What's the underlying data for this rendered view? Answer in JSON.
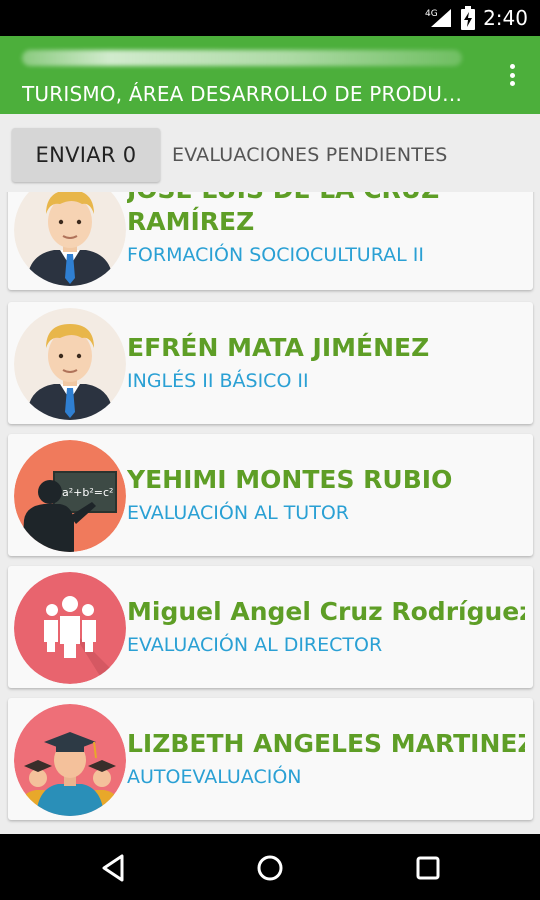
{
  "status_bar": {
    "network_label": "4G",
    "time": "2:40"
  },
  "app_bar": {
    "title": "TURISMO, ÁREA DESARROLLO DE PRODUCT...",
    "color": "#4caf3b"
  },
  "actions": {
    "send_label": "ENVIAR 0",
    "pending_label": "EVALUACIONES PENDIENTES"
  },
  "evaluations": [
    {
      "name_lines": [
        "JOSÉ LUIS DE LA CRUZ",
        "RAMÍREZ"
      ],
      "subject": "FORMACIÓN SOCIOCULTURAL II",
      "avatar": "male-teacher-avatar"
    },
    {
      "name_lines": [
        "EFRÉN MATA JIMÉNEZ"
      ],
      "subject": "INGLÉS II BÁSICO II",
      "avatar": "male-teacher-avatar"
    },
    {
      "name_lines": [
        "YEHIMI MONTES RUBIO"
      ],
      "subject": "EVALUACIÓN AL TUTOR",
      "avatar": "tutor-blackboard-avatar",
      "board_text": "a²+b²=c²"
    },
    {
      "name_lines": [
        "Miguel Angel Cruz Rodríguez"
      ],
      "subject": "EVALUACIÓN AL DIRECTOR",
      "avatar": "director-group-avatar"
    },
    {
      "name_lines": [
        "LIZBETH ANGELES MARTINEZ"
      ],
      "subject": "AUTOEVALUACIÓN",
      "avatar": "graduates-avatar"
    }
  ],
  "colors": {
    "name_green": "#5e9e26",
    "subject_blue": "#2aa0d4"
  },
  "nav": {
    "icons": [
      "back-icon",
      "home-icon",
      "recents-icon"
    ]
  }
}
